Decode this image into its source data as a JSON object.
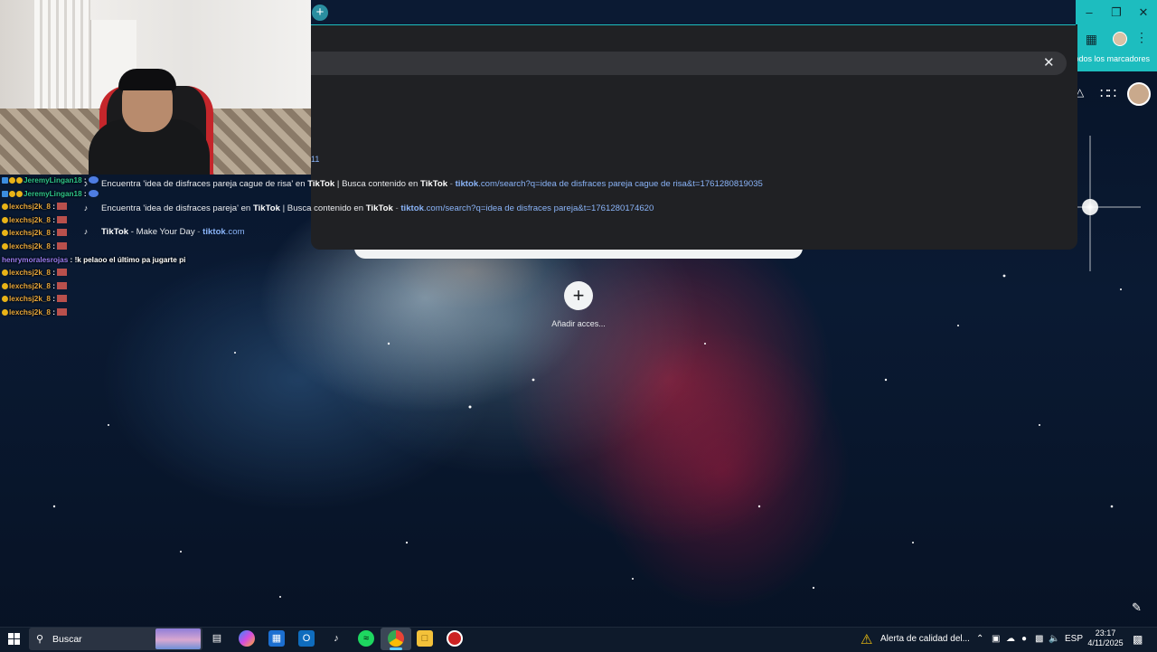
{
  "browser": {
    "bookmarks_label": "Todos los marcadores",
    "omnibox_fragment": "11",
    "suggestions": [
      {
        "parts": [
          {
            "t": "Encuentra 'idea de disfraces pareja cague de risa' en ",
            "s": "n"
          },
          {
            "t": "TikTok",
            "s": "b"
          },
          {
            "t": " | Busca contenido en ",
            "s": "n"
          },
          {
            "t": "TikTok",
            "s": "b"
          },
          {
            "t": " - ",
            "s": "d"
          },
          {
            "t": "tiktok",
            "s": "ub"
          },
          {
            "t": ".com/search?q=idea de disfraces pareja cague de risa&t=1761280819035",
            "s": "u"
          }
        ]
      },
      {
        "parts": [
          {
            "t": "Encuentra 'idea de disfraces pareja' en ",
            "s": "n"
          },
          {
            "t": "TikTok",
            "s": "b"
          },
          {
            "t": " | Busca contenido en ",
            "s": "n"
          },
          {
            "t": "TikTok",
            "s": "b"
          },
          {
            "t": " - ",
            "s": "d"
          },
          {
            "t": "tiktok",
            "s": "ub"
          },
          {
            "t": ".com/search?q=idea de disfraces pareja&t=1761280174620",
            "s": "u"
          }
        ]
      },
      {
        "parts": [
          {
            "t": "TikTok",
            "s": "b"
          },
          {
            "t": " - Make Your Day",
            "s": "n"
          },
          {
            "t": " - ",
            "s": "d"
          },
          {
            "t": "tiktok",
            "s": "ub"
          },
          {
            "t": ".com",
            "s": "u"
          }
        ]
      }
    ]
  },
  "newtab": {
    "add_shortcut_label": "Añadir acces..."
  },
  "chat": [
    {
      "badges": [
        "blue",
        "gold",
        "gold"
      ],
      "user": "JeremyLingan18",
      "color": "#2ec48a",
      "message": "",
      "emote": "blue"
    },
    {
      "badges": [
        "blue",
        "gold",
        "gold"
      ],
      "user": "JeremyLingan18",
      "color": "#2ec48a",
      "message": "",
      "emote": "blue"
    },
    {
      "badges": [
        "gold"
      ],
      "user": "lexchsj2k_8",
      "color": "#e5a53b",
      "message": "",
      "emote": "red"
    },
    {
      "badges": [
        "gold"
      ],
      "user": "lexchsj2k_8",
      "color": "#e5a53b",
      "message": "",
      "emote": "red"
    },
    {
      "badges": [
        "gold"
      ],
      "user": "lexchsj2k_8",
      "color": "#e5a53b",
      "message": "",
      "emote": "red"
    },
    {
      "badges": [
        "gold"
      ],
      "user": "lexchsj2k_8",
      "color": "#e5a53b",
      "message": "",
      "emote": "red"
    },
    {
      "badges": [],
      "user": "henrymoralesrojas",
      "color": "#9a7cf0",
      "message": "!k pelaoo el último pa jugarte pi",
      "emote": ""
    },
    {
      "badges": [
        "gold"
      ],
      "user": "lexchsj2k_8",
      "color": "#e5a53b",
      "message": "",
      "emote": "red"
    },
    {
      "badges": [
        "gold"
      ],
      "user": "lexchsj2k_8",
      "color": "#e5a53b",
      "message": "",
      "emote": "red"
    },
    {
      "badges": [
        "gold"
      ],
      "user": "lexchsj2k_8",
      "color": "#e5a53b",
      "message": "",
      "emote": "red"
    },
    {
      "badges": [
        "gold"
      ],
      "user": "lexchsj2k_8",
      "color": "#e5a53b",
      "message": "",
      "emote": "red"
    }
  ],
  "taskbar": {
    "search_placeholder": "Buscar",
    "alert_text": "Alerta de calidad del...",
    "language": "ESP",
    "time": "23:17",
    "date": "4/11/2025"
  },
  "colors": {
    "accent": "#1dbdbf",
    "link": "#8ab4f8",
    "omnibox_bg": "#202124"
  }
}
